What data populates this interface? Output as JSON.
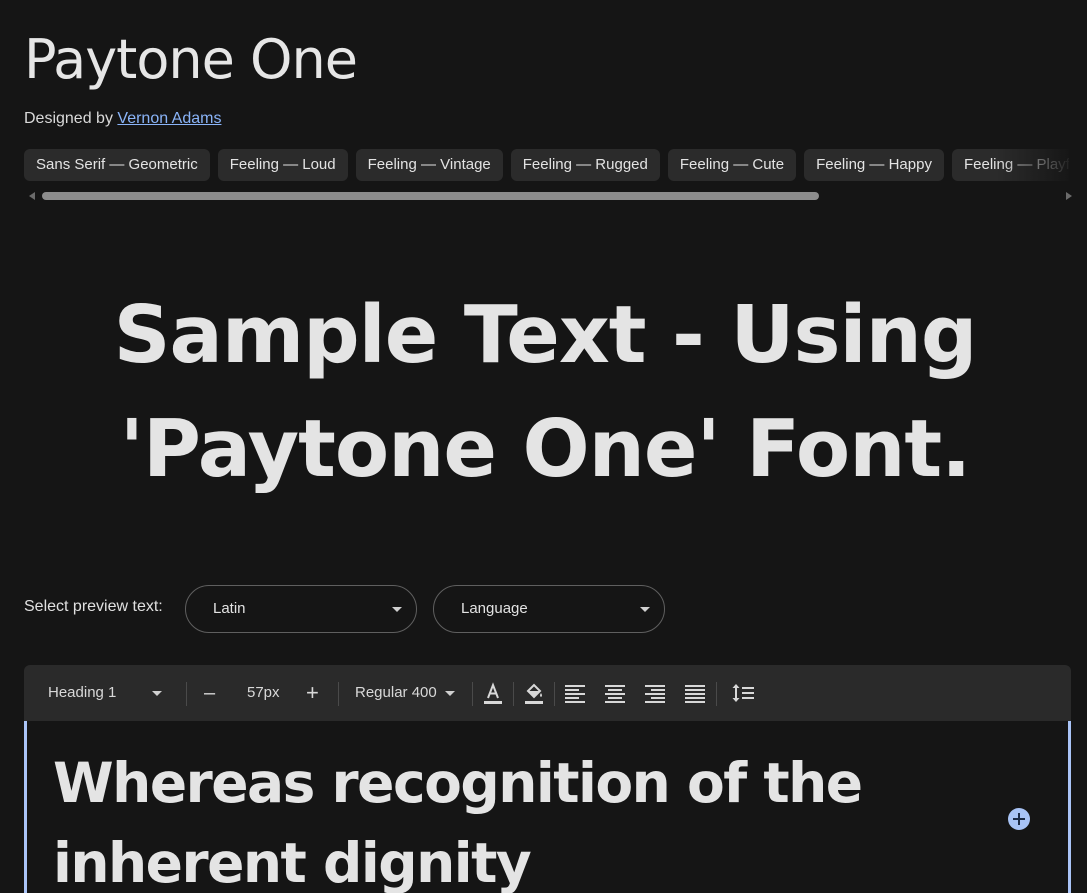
{
  "font": {
    "name": "Paytone One",
    "designed_by_prefix": "Designed by",
    "designer": "Vernon Adams"
  },
  "tags": [
    "Sans Serif — Geometric",
    "Feeling — Loud",
    "Feeling — Vintage",
    "Feeling — Rugged",
    "Feeling — Cute",
    "Feeling — Happy",
    "Feeling — Playful"
  ],
  "hero": {
    "line1": "Sample Text - Using",
    "line2": "'Paytone One' Font."
  },
  "preview": {
    "label": "Select preview text:",
    "script_select": "Latin",
    "language_select": "Language"
  },
  "toolbar": {
    "style_select": "Heading 1",
    "decrease": "–",
    "size": "57px",
    "increase": "+",
    "weight_select": "Regular 400"
  },
  "editor": {
    "text": "Whereas recognition of the inherent dignity"
  },
  "colors": {
    "background": "#151515",
    "chip": "#2b2b2b",
    "link": "#8ab4f8",
    "accent": "#aac4f7",
    "toolbar": "#2a2a2a"
  }
}
